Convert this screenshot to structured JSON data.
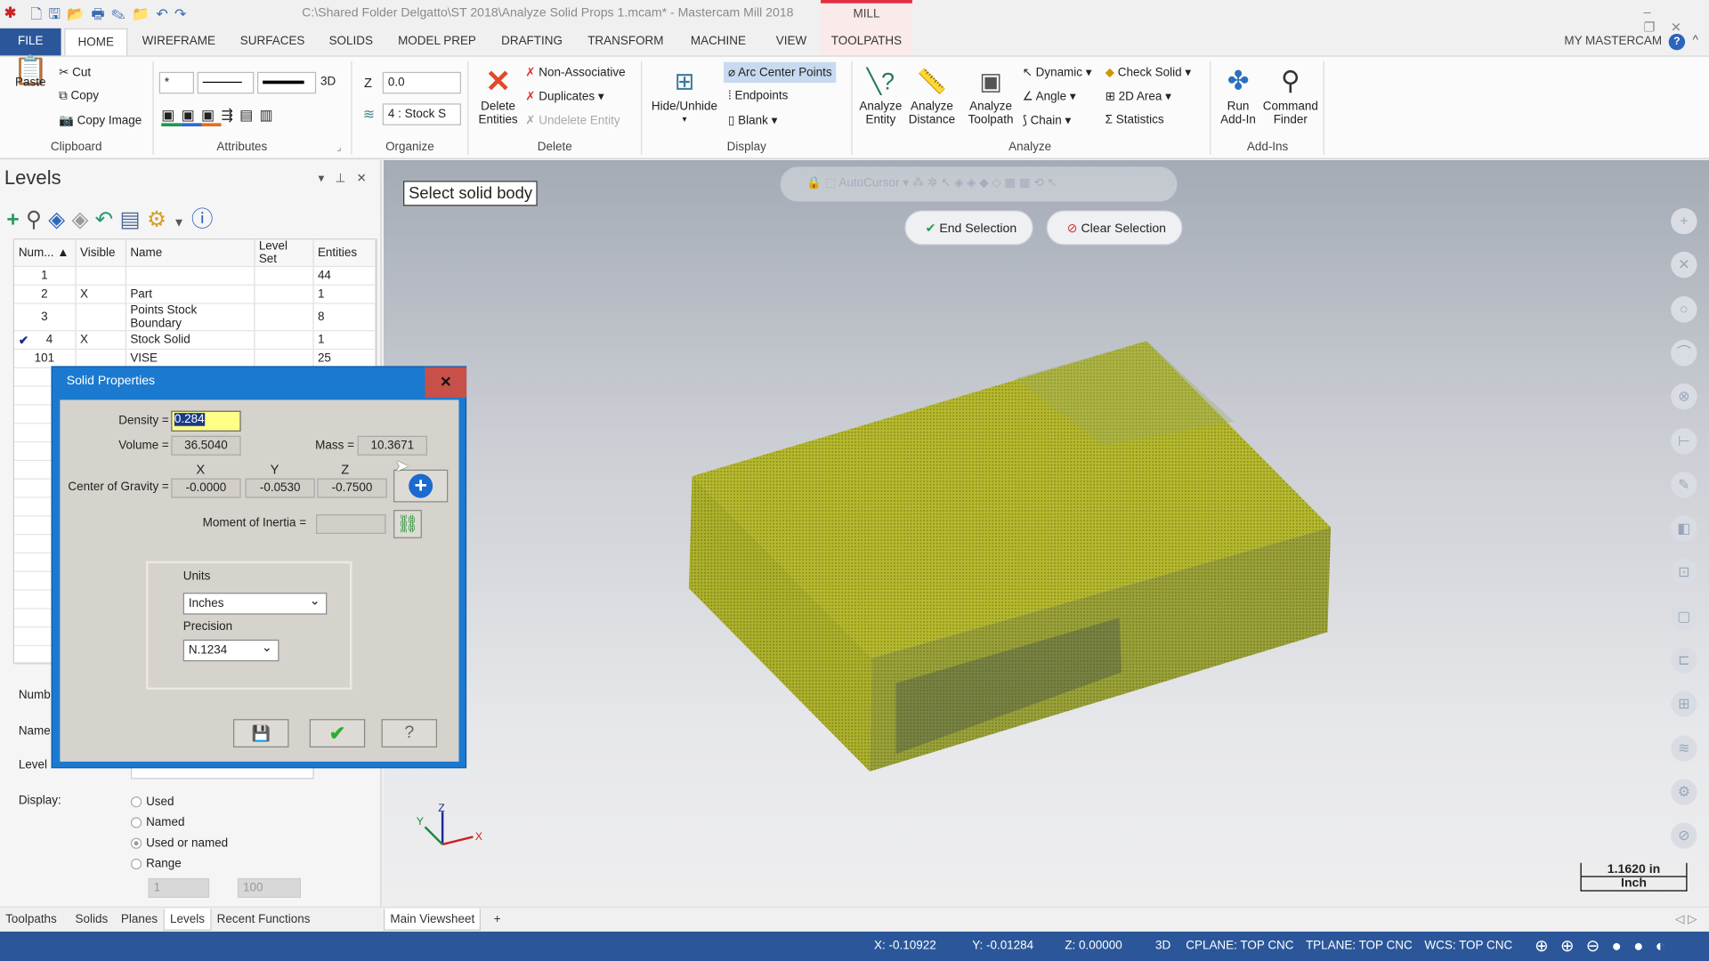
{
  "window": {
    "title": "C:\\Shared Folder Delgatto\\ST 2018\\Analyze Solid Props 1.mcam* - Mastercam Mill 2018",
    "context_tab": "MILL"
  },
  "tabs": [
    "FILE",
    "HOME",
    "WIREFRAME",
    "SURFACES",
    "SOLIDS",
    "MODEL PREP",
    "DRAFTING",
    "TRANSFORM",
    "MACHINE",
    "VIEW",
    "TOOLPATHS"
  ],
  "my_mastercam": "MY MASTERCAM",
  "ribbon": {
    "clipboard": {
      "label": "Clipboard",
      "paste": "Paste",
      "cut": "Cut",
      "copy": "Copy",
      "copy_image": "Copy Image"
    },
    "attributes": {
      "label": "Attributes",
      "mode": "3D",
      "point_style": "*"
    },
    "organize": {
      "label": "Organize",
      "z_label": "Z",
      "z_value": "0.0",
      "level_value": "4 : Stock S"
    },
    "delete": {
      "label": "Delete",
      "delete_entities": "Delete Entities",
      "non_associative": "Non-Associative",
      "duplicates": "Duplicates",
      "undelete": "Undelete Entity"
    },
    "display": {
      "label": "Display",
      "hide_unhide": "Hide/Unhide",
      "arc_center": "Arc Center Points",
      "endpoints": "Endpoints",
      "blank": "Blank"
    },
    "analyze": {
      "label": "Analyze",
      "entity": "Analyze Entity",
      "distance": "Analyze Distance",
      "toolpath": "Analyze Toolpath",
      "dynamic": "Dynamic",
      "angle": "Angle",
      "chain": "Chain",
      "check_solid": "Check Solid",
      "area2d": "2D Area",
      "statistics": "Statistics"
    },
    "addins": {
      "label": "Add-Ins",
      "run": "Run Add-In",
      "finder": "Command Finder"
    }
  },
  "levels": {
    "title": "Levels",
    "columns": [
      "Num...",
      "Visible",
      "Name",
      "Level Set",
      "Entities"
    ],
    "rows": [
      {
        "num": "1",
        "visible": "",
        "name": "",
        "set": "",
        "entities": "44",
        "active": false
      },
      {
        "num": "2",
        "visible": "X",
        "name": "Part",
        "set": "",
        "entities": "1",
        "active": false
      },
      {
        "num": "3",
        "visible": "",
        "name": "Points Stock Boundary",
        "set": "",
        "entities": "8",
        "active": false
      },
      {
        "num": "4",
        "visible": "X",
        "name": "Stock Solid",
        "set": "",
        "entities": "1",
        "active": true
      },
      {
        "num": "101",
        "visible": "",
        "name": "VISE",
        "set": "",
        "entities": "25",
        "active": false
      }
    ],
    "number_label": "Numb",
    "name_label": "Name",
    "level_label": "Level",
    "display_label": "Display:",
    "display_options": [
      {
        "label": "Used",
        "selected": false
      },
      {
        "label": "Named",
        "selected": false
      },
      {
        "label": "Used or named",
        "selected": true
      },
      {
        "label": "Range",
        "selected": false
      }
    ],
    "range_from": "1",
    "range_to": "100"
  },
  "bottom_tabs": [
    "Toolpaths",
    "Solids",
    "Planes",
    "Levels",
    "Recent Functions"
  ],
  "active_bottom_tab": "Levels",
  "viewsheet": {
    "tab": "Main Viewsheet",
    "add": "+"
  },
  "viewport": {
    "prompt": "Select solid body",
    "end_selection": "End Selection",
    "clear_selection": "Clear Selection",
    "autocursor": "AutoCursor",
    "scale_value": "1.1620 in",
    "scale_unit": "Inch",
    "axis": {
      "x": "X",
      "y": "Y",
      "z": "Z"
    },
    "solid_color": "#b4b82a"
  },
  "dialog": {
    "title": "Solid Properties",
    "density_label": "Density =",
    "density": "0.284",
    "volume_label": "Volume =",
    "volume": "36.5040",
    "mass_label": "Mass =",
    "mass": "10.3671",
    "cog_label": "Center of Gravity =",
    "cog_x": "-0.0000",
    "cog_y": "-0.0530",
    "cog_z": "-0.7500",
    "x": "X",
    "y": "Y",
    "z": "Z",
    "moi_label": "Moment of Inertia =",
    "moi": "",
    "units_label": "Units",
    "units": "Inches",
    "precision_label": "Precision",
    "precision": "N.1234"
  },
  "status": {
    "x": "X:  -0.10922",
    "y": "Y:  -0.01284",
    "z": "Z:  0.00000",
    "mode": "3D",
    "cplane": "CPLANE: TOP CNC",
    "tplane": "TPLANE: TOP CNC",
    "wcs": "WCS: TOP CNC"
  },
  "colors": {
    "file_tab": "#2b579a",
    "status_bar": "#2b579a",
    "dialog_frame": "#1b7ad0",
    "density_highlight": "#ffff88"
  }
}
